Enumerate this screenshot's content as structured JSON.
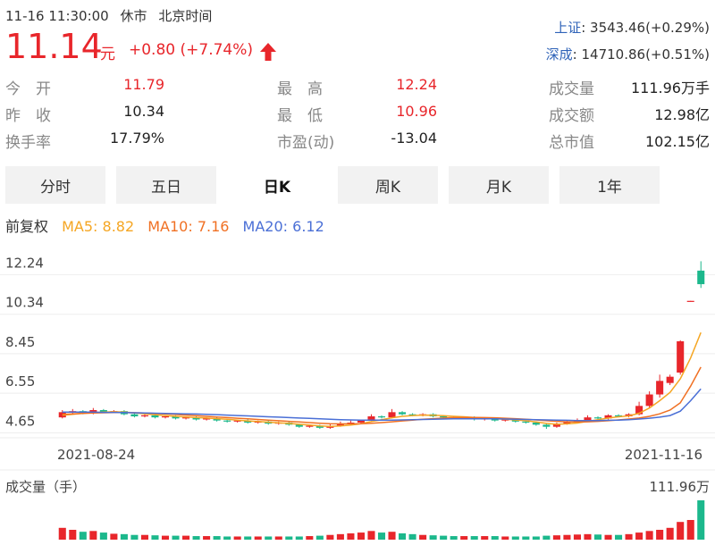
{
  "header": {
    "status_time": "11-16 11:30:00",
    "status": "休市",
    "tz": "北京时间",
    "price": "11.14",
    "unit": "元",
    "change": "+0.80 (+7.74%)",
    "indices": [
      {
        "name": "上证",
        "value": ": 3543.46(+0.29%)"
      },
      {
        "name": "深成",
        "value": ": 14710.86(+0.51%)"
      }
    ]
  },
  "stats": {
    "col1": [
      {
        "label": "今　开",
        "value": "11.79",
        "color": "red"
      },
      {
        "label": "昨　收",
        "value": "10.34",
        "color": "dark"
      },
      {
        "label": "换手率",
        "value": "17.79%",
        "color": "dark"
      }
    ],
    "col2": [
      {
        "label": "最　高",
        "value": "12.24",
        "color": "red"
      },
      {
        "label": "最　低",
        "value": "10.96",
        "color": "red"
      },
      {
        "label": "市盈(动)",
        "value": "-13.04",
        "color": "dark"
      }
    ],
    "col3": [
      {
        "label": "成交量",
        "value": "111.96万手",
        "color": "dark"
      },
      {
        "label": "成交额",
        "value": "12.98亿",
        "color": "dark"
      },
      {
        "label": "总市值",
        "value": "102.15亿",
        "color": "dark"
      }
    ]
  },
  "tabs": [
    {
      "label": "分时",
      "active": false
    },
    {
      "label": "五日",
      "active": false
    },
    {
      "label": "日K",
      "active": true
    },
    {
      "label": "周K",
      "active": false
    },
    {
      "label": "月K",
      "active": false
    },
    {
      "label": "1年",
      "active": false
    }
  ],
  "legend": {
    "adjust": "前复权",
    "ma5": "MA5: 8.82",
    "ma10": "MA10: 7.16",
    "ma20": "MA20: 6.12"
  },
  "colors": {
    "up": "#e8262b",
    "down": "#1cb88c",
    "ma5": "#f5a623",
    "ma10": "#f07023",
    "ma20": "#4a6fd6",
    "blue_text": "#2f63b8"
  },
  "chart_data": {
    "type": "candlestick",
    "y_ticks": [
      "12.24",
      "10.34",
      "8.45",
      "6.55",
      "4.65"
    ],
    "ylim": [
      4.2,
      12.6
    ],
    "x_labels": [
      "2021-08-24",
      "2021-11-16"
    ],
    "volume_label": "成交量（手）",
    "volume_max_label": "111.96万",
    "candles": [
      {
        "o": 4.75,
        "c": 5.0,
        "h": 5.1,
        "l": 4.7
      },
      {
        "o": 5.0,
        "c": 5.05,
        "h": 5.15,
        "l": 4.9
      },
      {
        "o": 5.05,
        "c": 4.95,
        "h": 5.1,
        "l": 4.9
      },
      {
        "o": 4.95,
        "c": 5.1,
        "h": 5.2,
        "l": 4.9
      },
      {
        "o": 5.1,
        "c": 5.0,
        "h": 5.15,
        "l": 4.95
      },
      {
        "o": 5.0,
        "c": 5.05,
        "h": 5.1,
        "l": 4.95
      },
      {
        "o": 5.05,
        "c": 4.9,
        "h": 5.1,
        "l": 4.85
      },
      {
        "o": 4.9,
        "c": 4.8,
        "h": 4.95,
        "l": 4.75
      },
      {
        "o": 4.8,
        "c": 4.85,
        "h": 4.9,
        "l": 4.75
      },
      {
        "o": 4.85,
        "c": 4.75,
        "h": 4.9,
        "l": 4.7
      },
      {
        "o": 4.75,
        "c": 4.8,
        "h": 4.85,
        "l": 4.7
      },
      {
        "o": 4.8,
        "c": 4.7,
        "h": 4.85,
        "l": 4.65
      },
      {
        "o": 4.7,
        "c": 4.75,
        "h": 4.8,
        "l": 4.65
      },
      {
        "o": 4.75,
        "c": 4.65,
        "h": 4.8,
        "l": 4.6
      },
      {
        "o": 4.65,
        "c": 4.7,
        "h": 4.75,
        "l": 4.6
      },
      {
        "o": 4.7,
        "c": 4.6,
        "h": 4.75,
        "l": 4.55
      },
      {
        "o": 4.6,
        "c": 4.55,
        "h": 4.65,
        "l": 4.5
      },
      {
        "o": 4.55,
        "c": 4.6,
        "h": 4.65,
        "l": 4.5
      },
      {
        "o": 4.6,
        "c": 4.5,
        "h": 4.65,
        "l": 4.45
      },
      {
        "o": 4.5,
        "c": 4.55,
        "h": 4.6,
        "l": 4.45
      },
      {
        "o": 4.55,
        "c": 4.45,
        "h": 4.6,
        "l": 4.4
      },
      {
        "o": 4.45,
        "c": 4.5,
        "h": 4.55,
        "l": 4.4
      },
      {
        "o": 4.5,
        "c": 4.4,
        "h": 4.55,
        "l": 4.35
      },
      {
        "o": 4.4,
        "c": 4.3,
        "h": 4.45,
        "l": 4.25
      },
      {
        "o": 4.3,
        "c": 4.35,
        "h": 4.4,
        "l": 4.25
      },
      {
        "o": 4.35,
        "c": 4.25,
        "h": 4.4,
        "l": 4.2
      },
      {
        "o": 4.25,
        "c": 4.35,
        "h": 4.45,
        "l": 4.2
      },
      {
        "o": 4.35,
        "c": 4.45,
        "h": 4.55,
        "l": 4.3
      },
      {
        "o": 4.45,
        "c": 4.5,
        "h": 4.6,
        "l": 4.4
      },
      {
        "o": 4.5,
        "c": 4.6,
        "h": 4.65,
        "l": 4.45
      },
      {
        "o": 4.6,
        "c": 4.8,
        "h": 4.9,
        "l": 4.55
      },
      {
        "o": 4.8,
        "c": 4.75,
        "h": 4.85,
        "l": 4.7
      },
      {
        "o": 4.75,
        "c": 5.0,
        "h": 5.15,
        "l": 4.7
      },
      {
        "o": 5.0,
        "c": 4.9,
        "h": 5.05,
        "l": 4.85
      },
      {
        "o": 4.9,
        "c": 4.85,
        "h": 4.95,
        "l": 4.8
      },
      {
        "o": 4.85,
        "c": 4.9,
        "h": 4.95,
        "l": 4.8
      },
      {
        "o": 4.9,
        "c": 4.8,
        "h": 4.95,
        "l": 4.75
      },
      {
        "o": 4.8,
        "c": 4.75,
        "h": 4.85,
        "l": 4.7
      },
      {
        "o": 4.75,
        "c": 4.7,
        "h": 4.8,
        "l": 4.65
      },
      {
        "o": 4.7,
        "c": 4.75,
        "h": 4.8,
        "l": 4.65
      },
      {
        "o": 4.75,
        "c": 4.65,
        "h": 4.8,
        "l": 4.6
      },
      {
        "o": 4.65,
        "c": 4.7,
        "h": 4.75,
        "l": 4.6
      },
      {
        "o": 4.7,
        "c": 4.6,
        "h": 4.75,
        "l": 4.55
      },
      {
        "o": 4.6,
        "c": 4.65,
        "h": 4.7,
        "l": 4.55
      },
      {
        "o": 4.65,
        "c": 4.55,
        "h": 4.7,
        "l": 4.5
      },
      {
        "o": 4.55,
        "c": 4.5,
        "h": 4.6,
        "l": 4.45
      },
      {
        "o": 4.5,
        "c": 4.4,
        "h": 4.55,
        "l": 4.35
      },
      {
        "o": 4.4,
        "c": 4.3,
        "h": 4.45,
        "l": 4.2
      },
      {
        "o": 4.3,
        "c": 4.45,
        "h": 4.5,
        "l": 4.25
      },
      {
        "o": 4.45,
        "c": 4.55,
        "h": 4.6,
        "l": 4.4
      },
      {
        "o": 4.55,
        "c": 4.6,
        "h": 4.7,
        "l": 4.5
      },
      {
        "o": 4.6,
        "c": 4.75,
        "h": 4.85,
        "l": 4.55
      },
      {
        "o": 4.75,
        "c": 4.7,
        "h": 4.8,
        "l": 4.65
      },
      {
        "o": 4.7,
        "c": 4.85,
        "h": 4.9,
        "l": 4.65
      },
      {
        "o": 4.85,
        "c": 4.8,
        "h": 4.9,
        "l": 4.75
      },
      {
        "o": 4.8,
        "c": 4.9,
        "h": 4.95,
        "l": 4.75
      },
      {
        "o": 4.9,
        "c": 5.3,
        "h": 5.5,
        "l": 4.85
      },
      {
        "o": 5.3,
        "c": 5.85,
        "h": 6.0,
        "l": 5.2
      },
      {
        "o": 5.85,
        "c": 6.5,
        "h": 6.8,
        "l": 5.7
      },
      {
        "o": 6.4,
        "c": 6.7,
        "h": 6.8,
        "l": 6.3
      },
      {
        "o": 6.9,
        "c": 8.4,
        "h": 8.45,
        "l": 6.8
      },
      {
        "o": 10.3,
        "c": 10.34,
        "h": 10.34,
        "l": 10.3
      },
      {
        "o": 11.79,
        "c": 11.14,
        "h": 12.24,
        "l": 10.96
      }
    ],
    "ma5": [
      4.85,
      4.9,
      4.95,
      4.98,
      5.0,
      5.02,
      5.0,
      4.97,
      4.92,
      4.88,
      4.84,
      4.8,
      4.77,
      4.74,
      4.72,
      4.69,
      4.66,
      4.62,
      4.58,
      4.55,
      4.52,
      4.49,
      4.46,
      4.42,
      4.38,
      4.34,
      4.32,
      4.34,
      4.38,
      4.45,
      4.55,
      4.64,
      4.73,
      4.8,
      4.84,
      4.86,
      4.85,
      4.83,
      4.8,
      4.78,
      4.75,
      4.72,
      4.69,
      4.66,
      4.63,
      4.59,
      4.53,
      4.46,
      4.42,
      4.44,
      4.48,
      4.56,
      4.64,
      4.72,
      4.78,
      4.82,
      4.95,
      5.2,
      5.55,
      5.95,
      6.6,
      7.6,
      8.82
    ],
    "ma10": [
      4.9,
      4.92,
      4.94,
      4.96,
      4.97,
      4.98,
      4.98,
      4.97,
      4.96,
      4.94,
      4.92,
      4.89,
      4.86,
      4.83,
      4.8,
      4.77,
      4.74,
      4.71,
      4.68,
      4.65,
      4.62,
      4.59,
      4.56,
      4.53,
      4.5,
      4.47,
      4.45,
      4.44,
      4.44,
      4.45,
      4.47,
      4.5,
      4.54,
      4.58,
      4.62,
      4.66,
      4.69,
      4.72,
      4.74,
      4.75,
      4.75,
      4.74,
      4.73,
      4.71,
      4.69,
      4.66,
      4.63,
      4.59,
      4.56,
      4.54,
      4.53,
      4.54,
      4.56,
      4.59,
      4.63,
      4.67,
      4.72,
      4.8,
      4.92,
      5.1,
      5.45,
      6.25,
      7.16
    ],
    "ma20": [
      5.0,
      5.0,
      5.0,
      5.0,
      4.99,
      4.99,
      4.98,
      4.97,
      4.96,
      4.95,
      4.94,
      4.93,
      4.92,
      4.91,
      4.9,
      4.88,
      4.86,
      4.84,
      4.82,
      4.8,
      4.78,
      4.76,
      4.74,
      4.72,
      4.7,
      4.68,
      4.66,
      4.64,
      4.63,
      4.62,
      4.62,
      4.62,
      4.62,
      4.63,
      4.64,
      4.65,
      4.66,
      4.67,
      4.68,
      4.68,
      4.68,
      4.68,
      4.68,
      4.67,
      4.66,
      4.65,
      4.64,
      4.63,
      4.62,
      4.61,
      4.6,
      4.6,
      4.6,
      4.61,
      4.62,
      4.64,
      4.67,
      4.71,
      4.76,
      4.84,
      5.05,
      5.55,
      6.12
    ],
    "volume": [
      0.3,
      0.25,
      0.2,
      0.22,
      0.18,
      0.15,
      0.14,
      0.12,
      0.12,
      0.11,
      0.1,
      0.1,
      0.1,
      0.09,
      0.09,
      0.09,
      0.08,
      0.08,
      0.08,
      0.08,
      0.08,
      0.08,
      0.08,
      0.08,
      0.09,
      0.1,
      0.12,
      0.14,
      0.16,
      0.18,
      0.22,
      0.18,
      0.2,
      0.16,
      0.14,
      0.12,
      0.11,
      0.1,
      0.09,
      0.09,
      0.09,
      0.09,
      0.09,
      0.08,
      0.08,
      0.08,
      0.08,
      0.1,
      0.11,
      0.12,
      0.13,
      0.14,
      0.13,
      0.12,
      0.12,
      0.14,
      0.18,
      0.22,
      0.25,
      0.3,
      0.45,
      0.5,
      1.0
    ]
  }
}
